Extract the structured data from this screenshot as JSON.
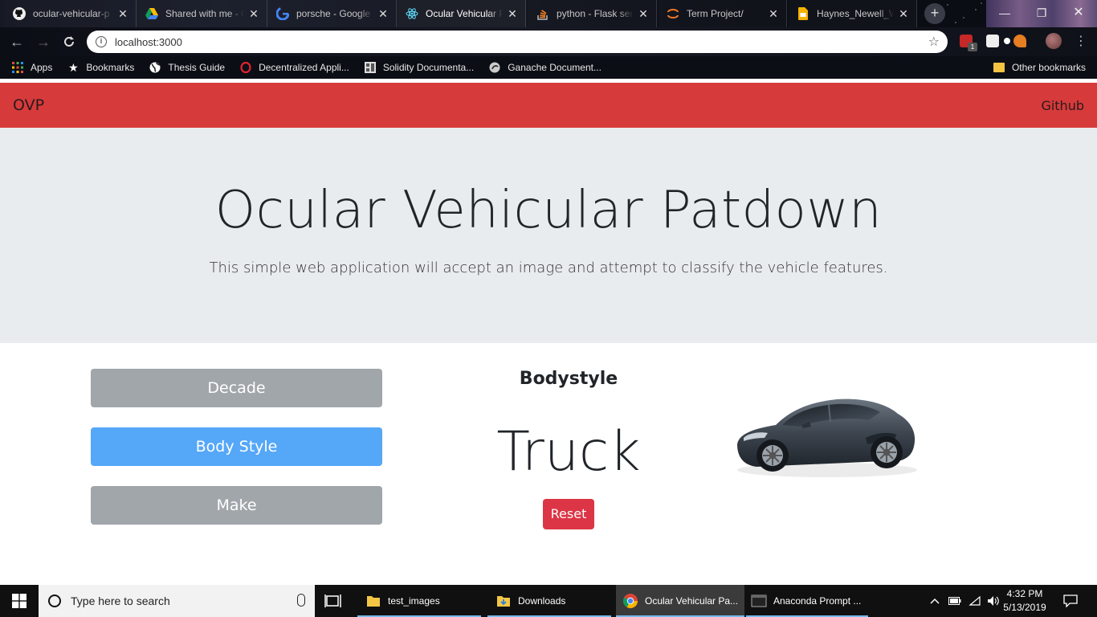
{
  "browser": {
    "tabs": [
      {
        "title": "ocular-vehicular-p",
        "icon": "github-icon"
      },
      {
        "title": "Shared with me - G",
        "icon": "google-drive-icon"
      },
      {
        "title": "porsche - Google",
        "icon": "google-icon"
      },
      {
        "title": "Ocular Vehicular P",
        "icon": "react-icon",
        "active": true
      },
      {
        "title": "python - Flask ser",
        "icon": "stackoverflow-icon"
      },
      {
        "title": "Term Project/",
        "icon": "jupyter-icon"
      },
      {
        "title": "Haynes_Newell_W",
        "icon": "slides-icon"
      }
    ],
    "url": "localhost:3000",
    "bookmarks": [
      {
        "label": "Apps",
        "icon": "apps-grid-icon"
      },
      {
        "label": "Bookmarks",
        "icon": "star-icon"
      },
      {
        "label": "Thesis Guide",
        "icon": "globe-icon"
      },
      {
        "label": "Decentralized Appli...",
        "icon": "opera-icon"
      },
      {
        "label": "Solidity Documenta...",
        "icon": "solidity-icon"
      },
      {
        "label": "Ganache Document...",
        "icon": "ganache-icon"
      }
    ],
    "other_bookmarks": "Other bookmarks",
    "extension_badge": "1"
  },
  "app": {
    "brand": "OVP",
    "nav_link": "Github",
    "title": "Ocular Vehicular Patdown",
    "lead": "This simple web application will accept an image and attempt to classify the vehicle features.",
    "categories": [
      {
        "label": "Decade",
        "selected": false
      },
      {
        "label": "Body Style",
        "selected": true
      },
      {
        "label": "Make",
        "selected": false
      }
    ],
    "result_heading": "Bodystyle",
    "prediction": "Truck",
    "reset_label": "Reset",
    "colors": {
      "navbar": "#d63a3b",
      "selected": "#55a7f8",
      "unselected": "#a1a6ab",
      "reset": "#dc3545",
      "jumbotron": "#e9ecef"
    }
  },
  "taskbar": {
    "search_placeholder": "Type here to search",
    "items": [
      {
        "label": "test_images",
        "icon": "folder-icon"
      },
      {
        "label": "Downloads",
        "icon": "downloads-folder-icon"
      },
      {
        "label": "Ocular Vehicular Pa...",
        "icon": "chrome-icon",
        "active": true
      },
      {
        "label": "Anaconda Prompt ...",
        "icon": "terminal-icon"
      }
    ],
    "time": "4:32 PM",
    "date": "5/13/2019"
  }
}
